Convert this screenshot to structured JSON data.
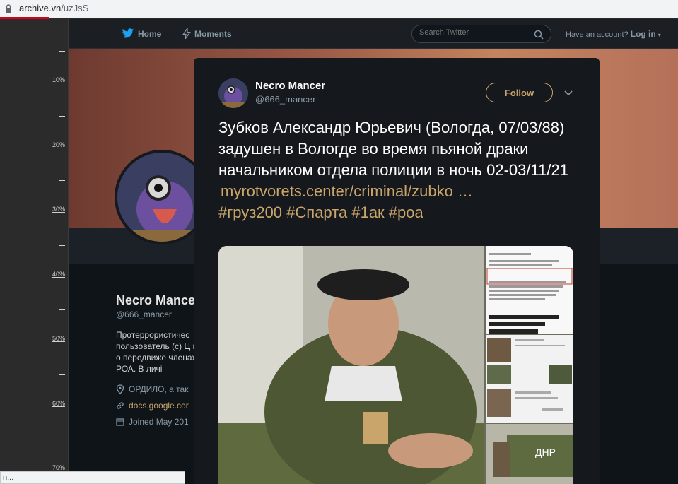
{
  "browser": {
    "url_host": "archive.vn",
    "url_path": "/uzJsS",
    "status_text": "n..."
  },
  "ruler": {
    "labels": [
      "10%",
      "20%",
      "30%",
      "40%",
      "50%",
      "60%",
      "70%"
    ]
  },
  "twitter_nav": {
    "home_label": "Home",
    "moments_label": "Moments",
    "search_placeholder": "Search Twitter",
    "have_account": "Have an account?",
    "login_label": "Log in"
  },
  "profile": {
    "name": "Necro Mance",
    "handle": "@666_mancer",
    "bio": "Протеррористичес пользователь (с) Ц инфу о передвиже членах РОА. В личі",
    "location": "ОРДИЛО, а так",
    "website": "docs.google.cor",
    "joined": "Joined May 201"
  },
  "tweet": {
    "author_name": "Necro Mancer",
    "author_handle": "@666_mancer",
    "follow_label": "Follow",
    "text": "Зубков Александр Юрьевич (Вологда, 07/03/88) задушен в Вологде во время пьяной драки начальником отдела полиции в ночь 02-03/11/21",
    "link": "myrotvorets.center/criminal/zubko …",
    "hashtags": "#груз200 #Спарта #1ак #роа"
  },
  "colors": {
    "accent": "#c9a56b",
    "modal_bg": "#15181c",
    "page_bg": "#0f1419"
  }
}
